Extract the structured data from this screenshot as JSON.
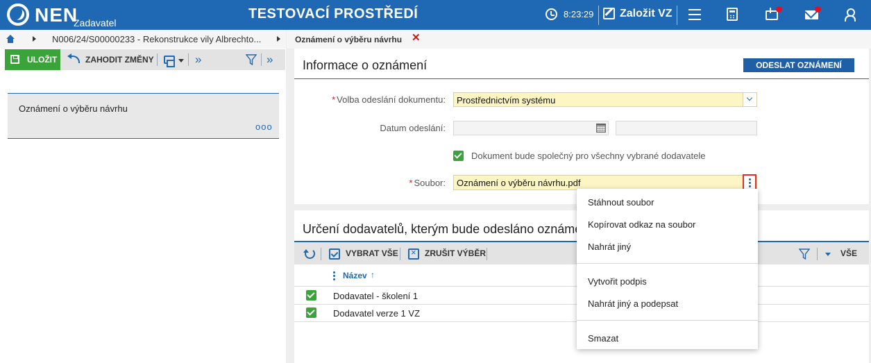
{
  "topbar": {
    "logo": "NEN",
    "logo_sub": "Zadavatel",
    "environment": "TESTOVACÍ PROSTŘEDÍ",
    "clock": "8:23:29",
    "create_label": "Založit VZ",
    "icons": [
      "clock-icon",
      "edit-icon",
      "menu-icon",
      "calculator-icon",
      "inbox-icon",
      "mail-icon",
      "user-icon"
    ],
    "notification_color": "#e0102a",
    "background_color": "#1f68b3"
  },
  "breadcrumb": {
    "path": "N006/24/S00000233 - Rekonstrukce vily Albrechto..."
  },
  "left_toolbar": {
    "save_label": "ULOŽIT",
    "discard_label": "ZAHODIT ZMĚNY",
    "save_color": "#3aa33a"
  },
  "left_list": {
    "items": [
      {
        "title": "Oznámení o výběru návrhu",
        "more": "ooo"
      }
    ]
  },
  "tab": {
    "label": "Oznámení o výběru návrhu",
    "close": "✕"
  },
  "info_panel": {
    "title": "Informace o oznámení",
    "send_button": "ODESLAT OZNÁMENÍ",
    "fields": {
      "send_method_label": "Volba odeslání dokumentu:",
      "send_method_value": "Prostřednictvím systému",
      "date_label": "Datum odeslání:",
      "date_value": "",
      "time_value": "",
      "common_checkbox_label": "Dokument bude společný pro všechny vybrané dodavatele",
      "common_checkbox_checked": true,
      "file_label": "Soubor:",
      "file_value": "Oznámení o výběru návrhu.pdf"
    }
  },
  "suppliers_panel": {
    "title": "Určení dodavatelů, kterým bude odesláno oznámení",
    "toolbar": {
      "select_all": "VYBRAT VŠE",
      "deselect": "ZRUŠIT VÝBĚR",
      "all_label": "VŠE"
    },
    "column_name": "Název",
    "sort_symbol": "↑",
    "rows": [
      {
        "name": "Dodavatel - školení 1",
        "checked": true
      },
      {
        "name": "Dodavatel verze 1 VZ",
        "checked": true
      }
    ]
  },
  "context_menu": {
    "items": [
      "Stáhnout soubor",
      "Kopírovat odkaz na soubor",
      "Nahrát jiný",
      "Vytvořit podpis",
      "Nahrát jiný a podepsat",
      "Smazat"
    ]
  }
}
